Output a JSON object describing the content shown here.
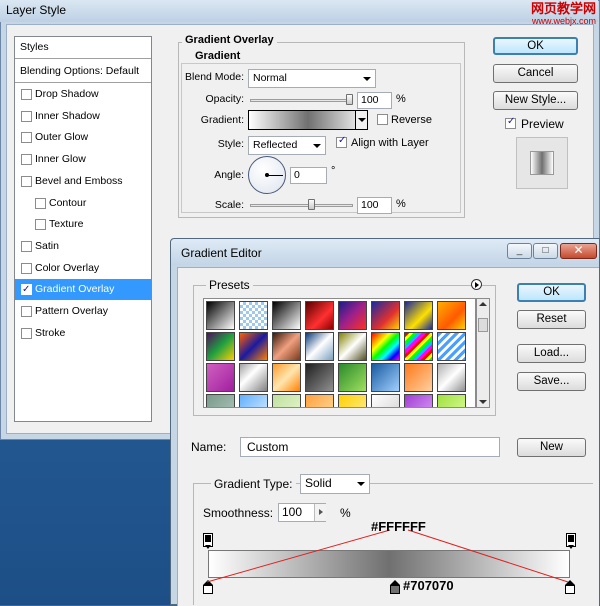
{
  "watermark": {
    "line1": "网页教学网",
    "line2": "www.webjx.com"
  },
  "layer_style": {
    "title": "Layer Style",
    "list": {
      "header": "Styles",
      "blending": "Blending Options: Default",
      "items": [
        {
          "label": "Drop Shadow",
          "checked": false,
          "indent": false
        },
        {
          "label": "Inner Shadow",
          "checked": false,
          "indent": false
        },
        {
          "label": "Outer Glow",
          "checked": false,
          "indent": false
        },
        {
          "label": "Inner Glow",
          "checked": false,
          "indent": false
        },
        {
          "label": "Bevel and Emboss",
          "checked": false,
          "indent": false
        },
        {
          "label": "Contour",
          "checked": false,
          "indent": true
        },
        {
          "label": "Texture",
          "checked": false,
          "indent": true
        },
        {
          "label": "Satin",
          "checked": false,
          "indent": false
        },
        {
          "label": "Color Overlay",
          "checked": false,
          "indent": false
        },
        {
          "label": "Gradient Overlay",
          "checked": true,
          "indent": false,
          "selected": true
        },
        {
          "label": "Pattern Overlay",
          "checked": false,
          "indent": false
        },
        {
          "label": "Stroke",
          "checked": false,
          "indent": false
        }
      ]
    },
    "panel": {
      "outer_title": "Gradient Overlay",
      "inner_title": "Gradient",
      "blend_mode_label": "Blend Mode:",
      "blend_mode_value": "Normal",
      "opacity_label": "Opacity:",
      "opacity_value": "100",
      "opacity_unit": "%",
      "opacity_level": 1.0,
      "gradient_label": "Gradient:",
      "reverse_label": "Reverse",
      "reverse_checked": false,
      "style_label": "Style:",
      "style_value": "Reflected",
      "align_label": "Align with Layer",
      "align_checked": true,
      "angle_label": "Angle:",
      "angle_value": "0",
      "angle_unit": "°",
      "scale_label": "Scale:",
      "scale_value": "100",
      "scale_unit": "%"
    },
    "buttons": {
      "ok": "OK",
      "cancel": "Cancel",
      "new_style": "New Style...",
      "preview_label": "Preview",
      "preview_checked": true
    }
  },
  "gradient_editor": {
    "title": "Gradient Editor",
    "window_buttons": {
      "minimize": "_",
      "maximize": "□",
      "close": "✕"
    },
    "presets_label": "Presets",
    "buttons": {
      "ok": "OK",
      "reset": "Reset",
      "load": "Load...",
      "save": "Save...",
      "new": "New"
    },
    "name_label": "Name:",
    "name_value": "Custom",
    "type_label": "Gradient Type:",
    "type_value": "Solid",
    "smoothness_label": "Smoothness:",
    "smoothness_value": "100",
    "smoothness_unit": "%",
    "annotation_white": "#FFFFFF",
    "annotation_gray": "#707070",
    "stops": [
      {
        "color": "#FFFFFF",
        "location": 0
      },
      {
        "color": "#707070",
        "location": 0.5
      },
      {
        "color": "#FFFFFF",
        "location": 1
      }
    ]
  }
}
